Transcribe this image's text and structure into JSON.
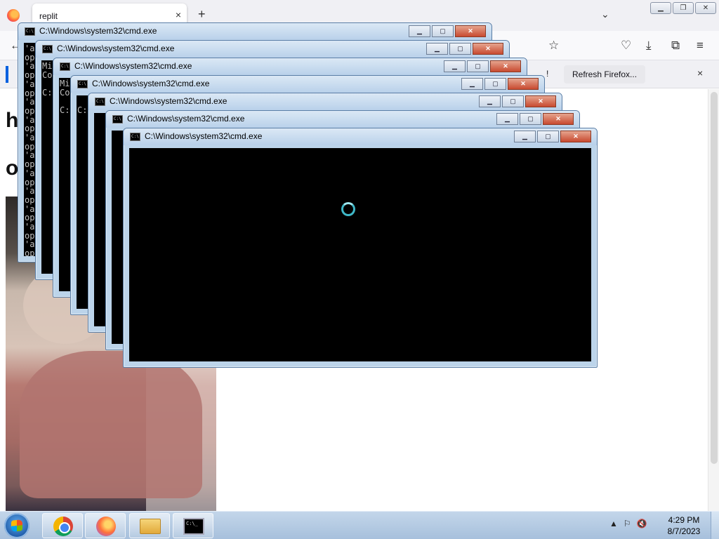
{
  "browser": {
    "tab_title": "replit",
    "tab_close": "×",
    "new_tab": "+",
    "tab_list": "⌄",
    "window_buttons": {
      "minimize": "▁",
      "restore": "❐",
      "close": "✕"
    },
    "nav_icons": {
      "back": "←",
      "pocket": "♡",
      "downloads": "⤓",
      "extensions": "⧉",
      "menu": "≡",
      "star": "☆"
    },
    "notification": {
      "button_label": "Refresh Firefox...",
      "close": "×",
      "trailing_char": "!"
    }
  },
  "page": {
    "heading_1": "h",
    "heading_2": "o"
  },
  "cmd_window_title": "C:\\Windows\\system32\\cmd.exe",
  "cmd_buttons": {
    "minimize": "▁",
    "maximize": "▢",
    "close": "✕"
  },
  "cmd_scroll": {
    "up": "▲",
    "down": "▼"
  },
  "cmd_windows": [
    {
      "title": "C:\\Windows\\system32\\cmd.exe",
      "body": "'a\nop\n'a\nop\n'a\nop\n'a\nop\n'a\nop\n'a\nop\n'a\nop\n'a\nop\n'a\nop\n'a\nop\n'a\nop\n'a\nop\n'a\nop"
    },
    {
      "title": "C:\\Windows\\system32\\cmd.exe",
      "body": "Mi\nCo\n\nC:"
    },
    {
      "title": "C:\\Windows\\system32\\cmd.exe",
      "body": "Mi\nCo\n\nC:"
    },
    {
      "title": "C:\\Windows\\system32\\cmd.exe",
      "body": "\nC: Us"
    },
    {
      "title": "C:\\Windows\\system32\\cmd.exe",
      "body": ""
    },
    {
      "title": "C:\\Windows\\system32\\cmd.exe",
      "body": ""
    },
    {
      "title": "C:\\Windows\\system32\\cmd.exe",
      "body": ""
    }
  ],
  "taskbar": {
    "cmd_icon_text": "C:\\_",
    "clock_time": "4:29 PM",
    "clock_date": "8/7/2023",
    "tray_icons": {
      "show_hidden": "▲",
      "network": "⚐",
      "volume": "🔇"
    }
  }
}
